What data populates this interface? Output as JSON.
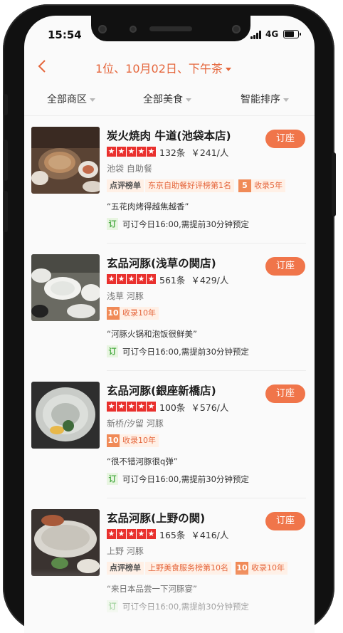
{
  "status": {
    "time": "15:54",
    "network": "4G"
  },
  "nav": {
    "title": "1位、10月02日、下午茶"
  },
  "filters": [
    "全部商区",
    "全部美食",
    "智能排序"
  ],
  "restaurants": [
    {
      "name": "炭火焼肉 牛道(池袋本店)",
      "reviews": "132条",
      "price": "￥241/人",
      "area": "池袋  自助餐",
      "rank_tag": "点评榜单",
      "rank_text": "东京自助餐好评榜第1名",
      "years_num": "5",
      "years_text": "收录5年",
      "quote": "“五花肉烤得越焦越香”",
      "avail_tag": "订",
      "avail": "可订今日16:00,需提前30分钟预定",
      "book": "订座"
    },
    {
      "name": "玄品河豚(浅草の関店)",
      "reviews": "561条",
      "price": "￥429/人",
      "area": "浅草  河豚",
      "rank_tag": "",
      "rank_text": "",
      "years_num": "10",
      "years_text": "收录10年",
      "quote": "“河豚火锅和泡饭很鲜美”",
      "avail_tag": "订",
      "avail": "可订今日16:00,需提前30分钟预定",
      "book": "订座"
    },
    {
      "name": "玄品河豚(銀座新橋店)",
      "reviews": "100条",
      "price": "￥576/人",
      "area": "新桥/汐留  河豚",
      "rank_tag": "",
      "rank_text": "",
      "years_num": "10",
      "years_text": "收录10年",
      "quote": "“很不错河豚很q弹”",
      "avail_tag": "订",
      "avail": "可订今日16:00,需提前30分钟预定",
      "book": "订座"
    },
    {
      "name": "玄品河豚(上野の関)",
      "reviews": "165条",
      "price": "￥416/人",
      "area": "上野  河豚",
      "rank_tag": "点评榜单",
      "rank_text": "上野美食服务榜第10名",
      "years_num": "10",
      "years_text": "收录10年",
      "quote": "“来日本品尝一下河豚宴”",
      "avail_tag": "订",
      "avail": "可订今日16:00,需提前30分钟预定",
      "book": "订座"
    }
  ],
  "colors": {
    "accent": "#e5663c",
    "button": "#f0754a",
    "star": "#e9302d"
  }
}
